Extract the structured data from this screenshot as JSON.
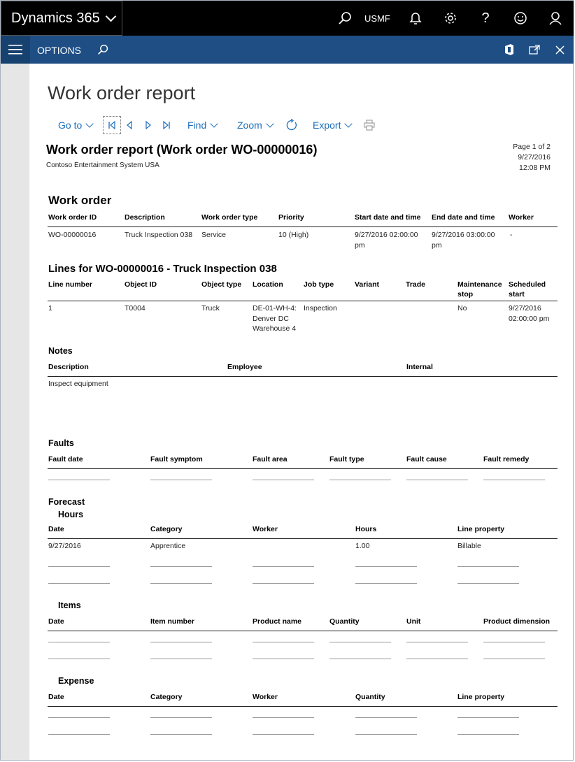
{
  "topbar": {
    "app_name": "Dynamics 365",
    "company": "USMF",
    "icons": [
      "search-icon",
      "bell-icon",
      "gear-icon",
      "help-icon",
      "smiley-icon",
      "user-icon"
    ]
  },
  "optionsbar": {
    "label": "OPTIONS",
    "icons": [
      "hamburger-icon",
      "search-icon",
      "office-icon",
      "popout-icon",
      "close-icon"
    ]
  },
  "page": {
    "title": "Work order report"
  },
  "toolbar": {
    "goto": "Go to",
    "find": "Find",
    "zoom": "Zoom",
    "export": "Export",
    "icons": [
      "first-page-icon",
      "prev-page-icon",
      "next-page-icon",
      "last-page-icon",
      "refresh-icon",
      "print-icon"
    ]
  },
  "report": {
    "title": "Work order report (Work order WO-00000016)",
    "company": "Contoso Entertainment System USA",
    "page": "Page 1 of 2",
    "date": "9/27/2016",
    "time": "12:08 PM",
    "work_order": {
      "heading": "Work order",
      "headers": [
        "Work order ID",
        "Description",
        "Work order type",
        "Priority",
        "Start date and time",
        "End date and time",
        "Worker"
      ],
      "row": [
        "WO-00000016",
        "Truck Inspection 038",
        "Service",
        "10 (High)",
        "9/27/2016 02:00:00 pm",
        "9/27/2016 03:00:00 pm",
        "-"
      ]
    },
    "lines": {
      "heading": "Lines for WO-00000016 - Truck Inspection 038",
      "headers": [
        "Line number",
        "Object ID",
        "Object type",
        "Location",
        "Job type",
        "Variant",
        "Trade",
        "Maintenance stop",
        "Scheduled start"
      ],
      "row": [
        "1",
        "T0004",
        "Truck",
        "DE-01-WH-4: Denver DC Warehouse 4",
        "Inspection",
        "",
        "",
        "No",
        "9/27/2016 02:00:00 pm"
      ]
    },
    "notes": {
      "heading": "Notes",
      "headers": [
        "Description",
        "Employee",
        "Internal"
      ],
      "row": [
        "Inspect equipment",
        "",
        ""
      ]
    },
    "faults": {
      "heading": "Faults",
      "headers": [
        "Fault date",
        "Fault symptom",
        "Fault area",
        "Fault type",
        "Fault cause",
        "Fault remedy"
      ]
    },
    "forecast": {
      "heading": "Forecast",
      "hours": {
        "heading": "Hours",
        "headers": [
          "Date",
          "Category",
          "Worker",
          "Hours",
          "Line property"
        ],
        "row": [
          "9/27/2016",
          "Apprentice",
          "",
          "1.00",
          "Billable"
        ]
      },
      "items": {
        "heading": "Items",
        "headers": [
          "Date",
          "Item number",
          "Product name",
          "Quantity",
          "Unit",
          "Product dimension"
        ]
      },
      "expense": {
        "heading": "Expense",
        "headers": [
          "Date",
          "Category",
          "Worker",
          "Quantity",
          "Line property"
        ]
      }
    }
  }
}
